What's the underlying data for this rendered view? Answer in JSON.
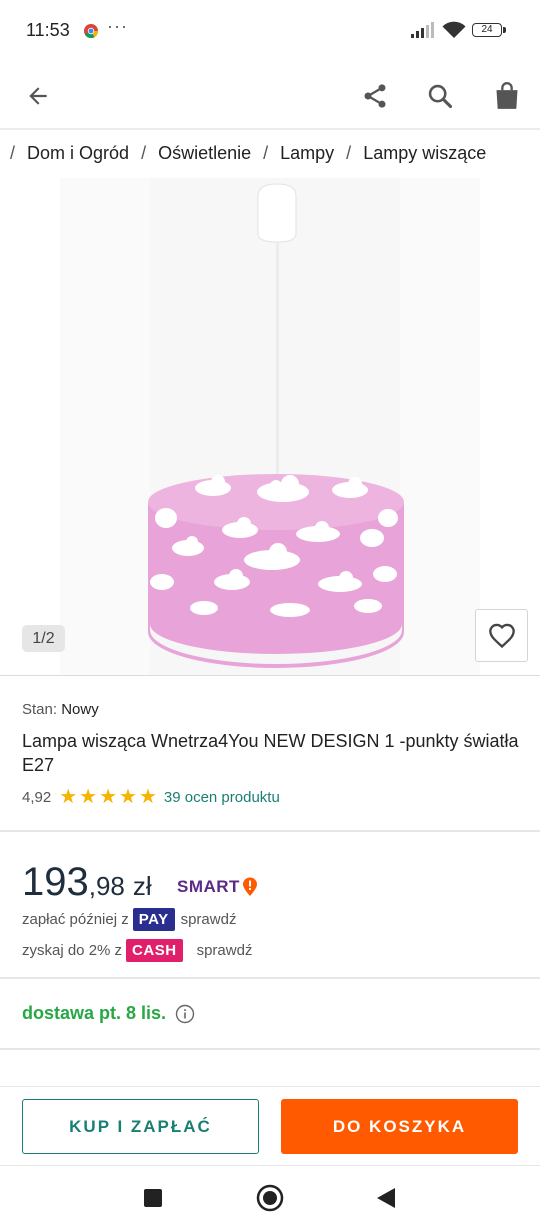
{
  "status_bar": {
    "time": "11:53",
    "more": "···",
    "battery": "24"
  },
  "app_bar": {
    "icons": [
      "back-arrow-icon",
      "share-icon",
      "search-icon",
      "shopping-bag-icon"
    ]
  },
  "breadcrumb": {
    "items": [
      "Dom i Ogród",
      "Oświetlenie",
      "Lampy",
      "Lampy wiszące"
    ],
    "separator": "/"
  },
  "gallery": {
    "counter": "1/2"
  },
  "product": {
    "condition_label": "Stan:",
    "condition_value": "Nowy",
    "title": "Lampa wisząca Wnetrza4You NEW DESIGN 1 -punkty światła E27",
    "rating_value": "4,92",
    "rating_stars": 5,
    "rating_count": "39 ocen produktu"
  },
  "price": {
    "main": "193",
    "fraction": ",98",
    "currency": "zł",
    "smart_label": "SMART"
  },
  "payment": {
    "pay_later_text": "zapłać później z",
    "pay_badge": "PAY",
    "pay_link": "sprawdź",
    "cashback_text": "zyskaj do 2% z",
    "cash_badge": "CASH",
    "cash_link": "sprawdź"
  },
  "delivery": {
    "text": "dostawa pt. 8 lis."
  },
  "actions": {
    "buy_now": "KUP I ZAPŁAĆ",
    "add_to_cart": "DO KOSZYKA"
  },
  "colors": {
    "accent_teal": "#1a7f73",
    "accent_orange": "#ff5a00",
    "delivery_green": "#28a745",
    "star_yellow": "#f5b400",
    "lamp_pink": "#e8a4d8"
  }
}
